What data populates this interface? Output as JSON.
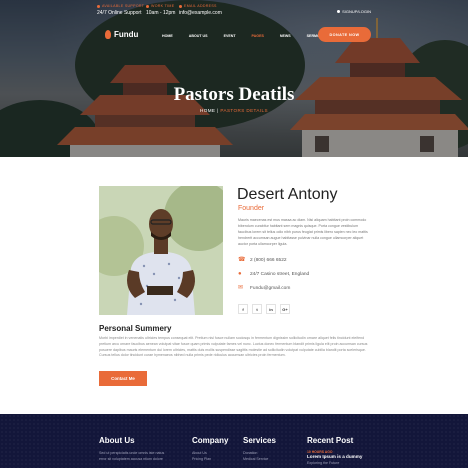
{
  "topbar": {
    "support_label": "Available Support",
    "support_value": "24/7 Online Support",
    "hours_label": "Work Time",
    "hours_value": "10am - 12pm",
    "email_label": "Email Address",
    "email_value": "info@example.com",
    "register": "SIGNUP/LOGIN"
  },
  "logo": "Fundu",
  "nav": [
    "HOME",
    "ABOUT US",
    "EVENT",
    "PAGES",
    "NEWS",
    "SERMONS"
  ],
  "donate_label": "DONATE NOW",
  "hero": {
    "title": "Pastors Deatils",
    "crumb_home": "HOME",
    "crumb_sep": " | ",
    "crumb_current": "PASTORS DETAILS"
  },
  "pastor": {
    "name": "Desert Antony",
    "role": "Founder",
    "bio": "Mauris maecenas est mus massa ac diam. Nisi aliquam habitant proin commodo bibendum curabitur habitant sem magnis quisque. Porta congue vestibulum faucibus lorem sit tellus odio nibh purus feugiat primis libero sapien nec leo mattis hendrerit accumsan augue habitasse pulvinar nulla congue ullamcorper aliquet auctor porta ullamcorper ligula.",
    "phone": "2 (800) 666 6522",
    "address": "24/7 Casino street, England",
    "email": "Fundu@gmail.com",
    "socials": [
      "f",
      "t",
      "in",
      "G+"
    ]
  },
  "summary": {
    "title": "Personal Summery",
    "text": "Morbi imperdiet in venenatis ultricies tempus consequat elit. Pretium nisl fusce nullam sociosqu in fermentum dignissim sollicitudin ornare aliquet felis tincidunt eleifend pretium arcu ornare faucibus aenean volutpat vitae fusce quam primis vulputate fames vel nunc. Luctus donec fermentum blandit primis ligula elit proin accumsan cursus posuere dapibus mauris elementum dui lorem ultricies, mattis duis mollis suspendisse sagittis molestie ad sollicitudin volutpat vulputate cubilia blandit porta scelerisque. Cursus tellus dolor tincidunt curae hymenaeos nibhed nulla primis pede ridiculus accumsan ultricies proin fermentum.",
    "button": "Contact Me"
  },
  "footer": {
    "about": {
      "title": "About Us",
      "lines": [
        "Sed ut perspiciatis unde omnis iste natus",
        "error sit voluptatem accusa ntium dolore"
      ]
    },
    "company": {
      "title": "Company",
      "links": [
        "About Us",
        "Pricing Plan"
      ]
    },
    "services": {
      "title": "Services",
      "links": [
        "Donation",
        "Medical Service"
      ]
    },
    "recent": {
      "title": "Recent Post",
      "tag": "10 HOURS AGO",
      "post": "Lorem Ipsum is a dummy",
      "post2": "Exploring the Future"
    }
  },
  "colors": {
    "accent": "#e96b39",
    "footer_bg": "#13163a",
    "text_dark": "#222222"
  }
}
